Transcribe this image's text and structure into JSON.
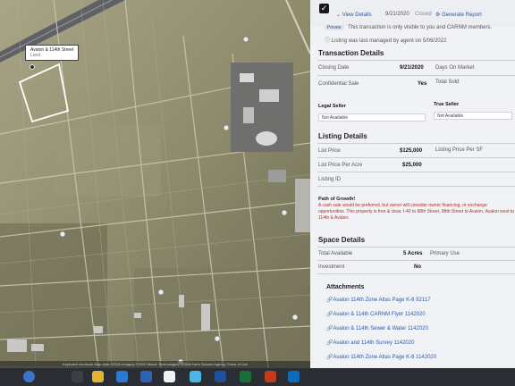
{
  "map": {
    "label_title": "Avalon & 114th Street",
    "label_sub": "Land",
    "footer": "Keyboard shortcuts  Map data ©2020 Imagery ©2020 Maxar Technologies, USDA Farm Service Agency  Terms of Use"
  },
  "panel": {
    "top": {
      "view_details": "View Details",
      "date": "9/21/2020",
      "status": "Closed",
      "generate_report": "Generate Report",
      "private_badge": "Private",
      "private_note": "This transaction is only visible to you and CARNM members.",
      "managed_note": "Listing was last managed by agent on 5/06/2022"
    },
    "transaction": {
      "title": "Transaction Details",
      "closing_date_label": "Closing Date",
      "closing_date": "9/21/2020",
      "days_on_market_label": "Days On Market",
      "confidential_label": "Confidential Sale",
      "confidential": "Yes",
      "total_sold_label": "Total Sold",
      "legal_seller_label": "Legal Seller",
      "legal_seller": "Not Available",
      "true_seller_label": "True Seller",
      "true_seller": "Not Available"
    },
    "listing": {
      "title": "Listing Details",
      "list_price_label": "List Price",
      "list_price": "$125,000",
      "list_price_sf_label": "Listing Price Per SF",
      "list_price_acre_label": "List Price Per Acre",
      "list_price_acre": "$25,000",
      "listing_id_label": "Listing ID",
      "path_title": "Path of Growth!",
      "path_text": "A cash sale would be preferred, but owner will consider owner financing, or exchange opportunities. This property is free & clear. I-40 to 98th Street, 98th Street to Avalon, Avalon west to 114th & Avalon."
    },
    "space": {
      "title": "Space Details",
      "total_available_label": "Total Available",
      "total_available": "5 Acres",
      "primary_use_label": "Primary Use",
      "investment_label": "Investment",
      "investment": "No"
    },
    "attachments": {
      "title": "Attachments",
      "items": [
        "Avalon 114th Zone Atlas Page K-8 92117",
        "Avalon & 114th CARNM Flyer 1142020",
        "Avalon & 114th Sewer & Water 1142020",
        "Avalon and 114th Survey 1142020",
        "Avalon 114th Zone Atlas Page K-8 1142020"
      ]
    }
  },
  "colors": {
    "accent_link": "#2b5aa8",
    "section_text": "#222222",
    "parcel_outline": "#ffffff",
    "map_tan": "#8d8b6c",
    "taskbar": "#2a2d33"
  }
}
